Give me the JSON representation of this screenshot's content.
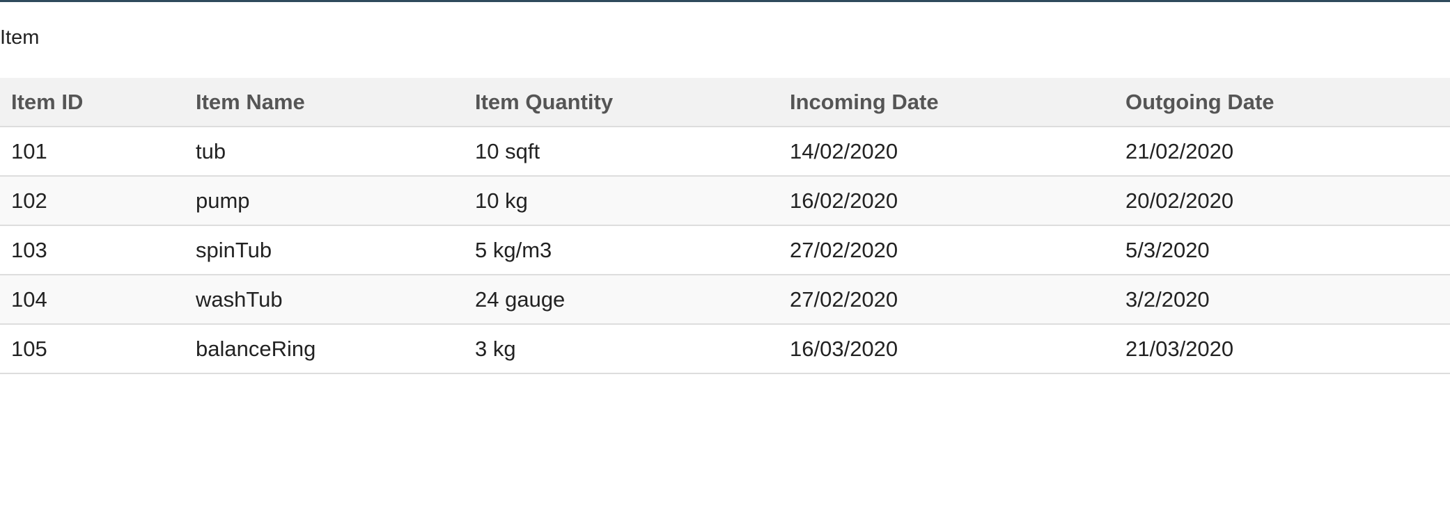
{
  "page": {
    "title": "Item"
  },
  "table": {
    "headers": [
      "Item ID",
      "Item Name",
      "Item Quantity",
      "Incoming Date",
      "Outgoing Date"
    ],
    "rows": [
      [
        "101",
        "tub",
        "10 sqft",
        "14/02/2020",
        "21/02/2020"
      ],
      [
        "102",
        "pump",
        "10 kg",
        "16/02/2020",
        "20/02/2020"
      ],
      [
        "103",
        "spinTub",
        "5 kg/m3",
        "27/02/2020",
        "5/3/2020"
      ],
      [
        "104",
        "washTub",
        "24 gauge",
        "27/02/2020",
        "3/2/2020"
      ],
      [
        "105",
        "balanceRing",
        "3 kg",
        "16/03/2020",
        "21/03/2020"
      ]
    ]
  },
  "colors": {
    "top_border": "#2f4a5c",
    "header_background": "#f2f2f2",
    "header_text": "#555555",
    "striped_row_background": "#f9f9f9",
    "row_border": "#dddddd"
  }
}
